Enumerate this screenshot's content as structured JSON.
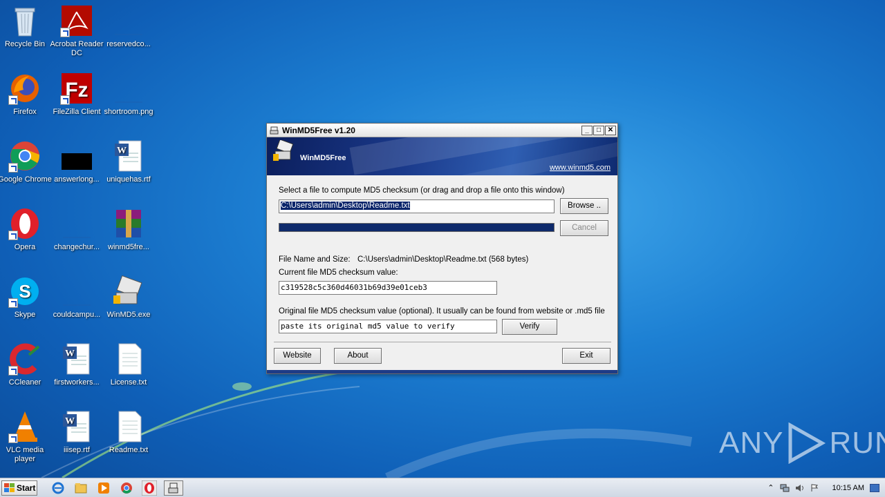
{
  "desktop": {
    "icons": [
      {
        "label": "Recycle Bin"
      },
      {
        "label": "Acrobat Reader DC"
      },
      {
        "label": "reservedco..."
      },
      {
        "label": "Firefox"
      },
      {
        "label": "FileZilla Client"
      },
      {
        "label": "shortroom.png"
      },
      {
        "label": "Google Chrome"
      },
      {
        "label": "answerlong..."
      },
      {
        "label": "uniquehas.rtf"
      },
      {
        "label": "Opera"
      },
      {
        "label": "changechur..."
      },
      {
        "label": "winmd5fre..."
      },
      {
        "label": "Skype"
      },
      {
        "label": "couldcampu..."
      },
      {
        "label": "WinMD5.exe"
      },
      {
        "label": "CCleaner"
      },
      {
        "label": "firstworkers..."
      },
      {
        "label": "License.txt"
      },
      {
        "label": "VLC media player"
      },
      {
        "label": "iiisep.rtf"
      },
      {
        "label": "Readme.txt"
      }
    ]
  },
  "window": {
    "title": "WinMD5Free v1.20",
    "banner_name": "WinMD5Free",
    "banner_url": "www.winmd5.com",
    "select_label": "Select a file to compute MD5 checksum (or drag and drop a file onto this window)",
    "file_path": "C:\\Users\\admin\\Desktop\\Readme.txt",
    "browse_label": "Browse ..",
    "cancel_label": "Cancel",
    "progress": 1.0,
    "file_name_size_label": "File Name and Size:",
    "file_name_size_value": "C:\\Users\\admin\\Desktop\\Readme.txt (568 bytes)",
    "current_md5_label": "Current file MD5 checksum value:",
    "current_md5_value": "c319528c5c360d46031b69d39e01ceb3",
    "original_md5_label": "Original file MD5 checksum value (optional). It usually can be found from website or .md5 file",
    "original_md5_placeholder": "paste its original md5 value to verify",
    "verify_label": "Verify",
    "website_label": "Website",
    "about_label": "About",
    "exit_label": "Exit"
  },
  "watermark": {
    "left": "ANY",
    "right": "RUN"
  },
  "taskbar": {
    "start_label": "Start",
    "clock": "10:15 AM"
  }
}
